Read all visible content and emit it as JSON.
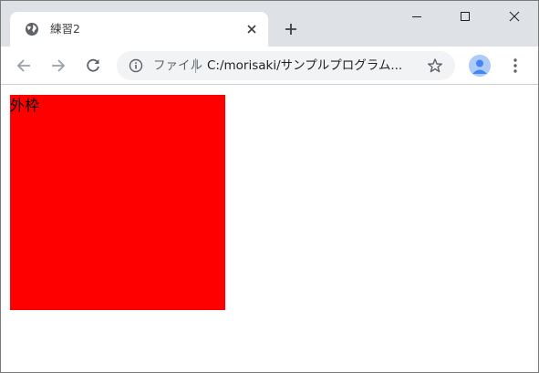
{
  "browser": {
    "tab": {
      "title": "練習2",
      "favicon": "globe-icon"
    },
    "window_controls": [
      "minimize-icon",
      "maximize-icon",
      "close-icon"
    ],
    "address_bar": {
      "security_chip": "ファイル",
      "url": "C:/morisaki/サンプルプログラム..."
    }
  },
  "page": {
    "box": {
      "label": "外枠",
      "background": "#ff0000"
    }
  },
  "colors": {
    "tabstrip": "#dee1e6",
    "omnibox": "#f1f3f4",
    "avatar": "#aecbfa"
  }
}
